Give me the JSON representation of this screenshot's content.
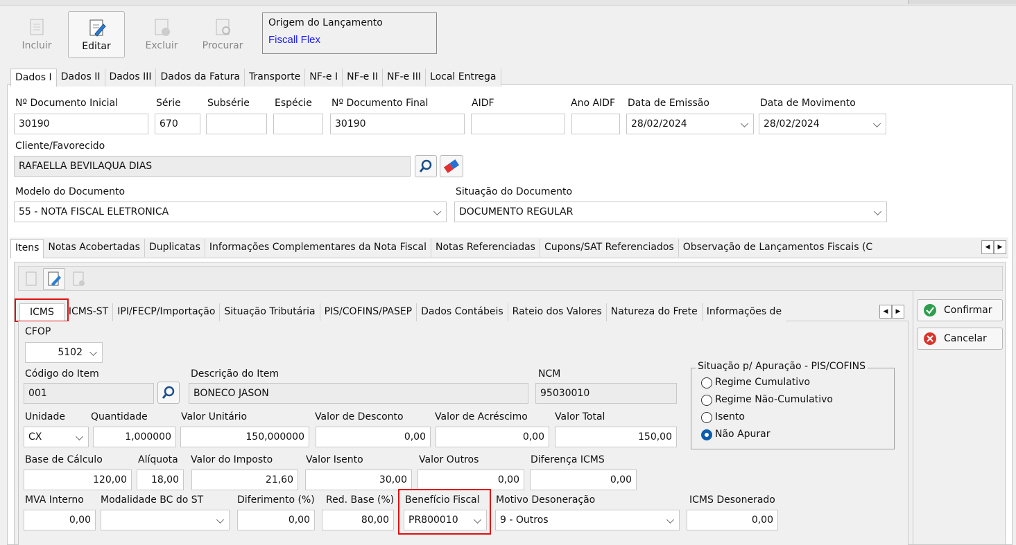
{
  "toolbar": {
    "incluir": "Incluir",
    "editar": "Editar",
    "excluir": "Excluir",
    "procurar": "Procurar",
    "origem_label": "Origem do Lançamento",
    "origem_value": "Fiscall Flex"
  },
  "top_tabs": [
    "Dados I",
    "Dados II",
    "Dados III",
    "Dados da Fatura",
    "Transporte",
    "NF-e I",
    "NF-e II",
    "NF-e III",
    "Local Entrega"
  ],
  "dados": {
    "doc_inicial_label": "Nº Documento Inicial",
    "doc_inicial": "30190",
    "serie_label": "Série",
    "serie": "670",
    "subserie_label": "Subsérie",
    "subserie": "",
    "especie_label": "Espécie",
    "especie": "",
    "doc_final_label": "Nº Documento Final",
    "doc_final": "30190",
    "aidf_label": "AIDF",
    "aidf": "",
    "ano_aidf_label": "Ano AIDF",
    "ano_aidf": "",
    "data_emissao_label": "Data de Emissão",
    "data_emissao": "28/02/2024",
    "data_mov_label": "Data de Movimento",
    "data_mov": "28/02/2024",
    "cliente_label": "Cliente/Favorecido",
    "cliente": "RAFAELLA BEVILAQUA DIAS",
    "modelo_label": "Modelo do Documento",
    "modelo": "55 - NOTA FISCAL ELETRONICA",
    "situacao_label": "Situação do Documento",
    "situacao": "DOCUMENTO REGULAR"
  },
  "mid_tabs": [
    "Itens",
    "Notas Acobertadas",
    "Duplicatas",
    "Informações Complementares da Nota Fiscal",
    "Notas Referenciadas",
    "Cupons/SAT Referenciados",
    "Observação de Lançamentos Fiscais (C"
  ],
  "item_tabs": [
    "ICMS",
    "ICMS-ST",
    "IPI/FECP/Importação",
    "Situação Tributária",
    "PIS/COFINS/PASEP",
    "Dados Contábeis",
    "Rateio dos Valores",
    "Natureza do Frete",
    "Informações de"
  ],
  "item": {
    "cfop_label": "CFOP",
    "cfop": "5102",
    "codigo_label": "Código do Item",
    "codigo": "001",
    "descricao_label": "Descrição do Item",
    "descricao": "BONECO JASON",
    "ncm_label": "NCM",
    "ncm": "95030010",
    "unidade_label": "Unidade",
    "unidade": "CX",
    "quantidade_label": "Quantidade",
    "quantidade": "1,000000",
    "valor_unit_label": "Valor Unitário",
    "valor_unit": "150,000000",
    "desconto_label": "Valor de Desconto",
    "desconto": "0,00",
    "acrescimo_label": "Valor de Acréscimo",
    "acrescimo": "0,00",
    "total_label": "Valor Total",
    "total": "150,00",
    "base_label": "Base de Cálculo",
    "base": "120,00",
    "aliquota_label": "Alíquota",
    "aliquota": "18,00",
    "imposto_label": "Valor do Imposto",
    "imposto": "21,60",
    "isento_label": "Valor Isento",
    "isento": "30,00",
    "outros_label": "Valor Outros",
    "outros": "0,00",
    "dif_icms_label": "Diferença ICMS",
    "dif_icms": "0,00",
    "mva_label": "MVA Interno",
    "mva": "0,00",
    "modalidade_label": "Modalidade BC do ST",
    "modalidade": "",
    "diferimento_label": "Diferimento (%)",
    "diferimento": "0,00",
    "red_base_label": "Red. Base (%)",
    "red_base": "80,00",
    "beneficio_label": "Benefício Fiscal",
    "beneficio": "PR800010",
    "motivo_label": "Motivo Desoneração",
    "motivo": "9 - Outros",
    "icms_deson_label": "ICMS Desonerado",
    "icms_deson": "0,00"
  },
  "pis_cofins": {
    "title": "Situação p/ Apuração - PIS/COFINS",
    "options": [
      "Regime Cumulativo",
      "Regime Não-Cumulativo",
      "Isento",
      "Não Apurar"
    ],
    "selected": "Não Apurar"
  },
  "actions": {
    "confirmar": "Confirmar",
    "cancelar": "Cancelar"
  },
  "colors": {
    "accent_blue": "#0b5cad",
    "highlight_red": "#e01010",
    "origin_blue": "#1a1aff"
  }
}
